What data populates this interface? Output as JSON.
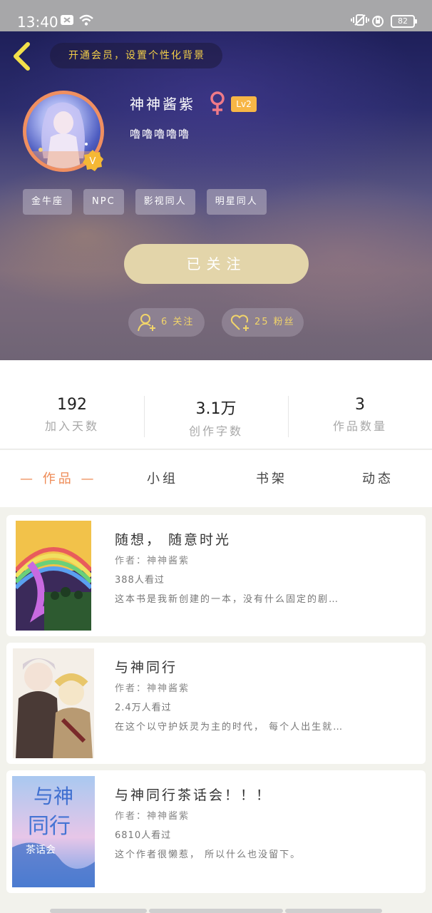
{
  "status": {
    "time": "13:40",
    "battery": "82"
  },
  "header": {
    "vip_banner": "开通会员，设置个性化背景",
    "username": "神神酱紫",
    "level": "Lv2",
    "signature": "嚕嚕嚕嚕嚕",
    "tags": [
      "金牛座",
      "NPC",
      "影视同人",
      "明星同人"
    ],
    "follow_button": "已关注",
    "following": "6 关注",
    "followers": "25 粉丝"
  },
  "stats": [
    {
      "value": "192",
      "label": "加入天数"
    },
    {
      "value": "3.1万",
      "label": "创作字数"
    },
    {
      "value": "3",
      "label": "作品数量"
    }
  ],
  "tabs": [
    "— 作品 —",
    "小组",
    "书架",
    "动态"
  ],
  "books": [
    {
      "title": "随想， 随意时光",
      "author": "作者：神神酱紫",
      "views": "388人看过",
      "desc": "这本书是我新创建的一本，没有什么固定的剧…"
    },
    {
      "title": "与神同行",
      "author": "作者：神神酱紫",
      "views": "2.4万人看过",
      "desc": "在这个以守护妖灵为主的时代， 每个人出生就…"
    },
    {
      "title": "与神同行茶话会！！！",
      "author": "作者：神神酱紫",
      "views": "6810人看过",
      "desc": "这个作者很懒惹， 所以什么也没留下。"
    }
  ],
  "cover3_text": "与神同行茶话会",
  "colors": {
    "accent": "#ee8a55",
    "gold": "#f3cf48",
    "follow_btn": "#e3d5aa"
  }
}
